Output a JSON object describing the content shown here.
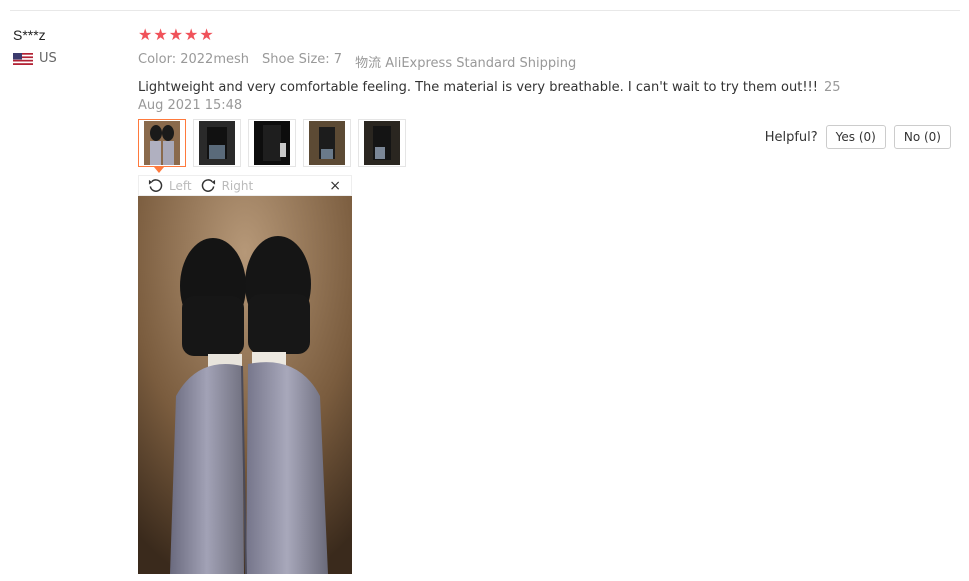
{
  "reviewer": {
    "name": "S***z",
    "country": "US"
  },
  "review": {
    "rating": 5,
    "attributes": [
      {
        "label": "Color:",
        "value": "2022mesh"
      },
      {
        "label": "Shoe Size:",
        "value": "7"
      },
      {
        "label": "物流",
        "value": "AliExpress Standard Shipping"
      }
    ],
    "text": "Lightweight and very comfortable feeling. The material is very breathable. I can't wait to try them out!!!",
    "date": "25 Aug 2021 15:48"
  },
  "thumbnails": [
    {
      "alt": "photo-1"
    },
    {
      "alt": "photo-2"
    },
    {
      "alt": "photo-3"
    },
    {
      "alt": "photo-4"
    },
    {
      "alt": "photo-5"
    }
  ],
  "helpful": {
    "label": "Helpful?",
    "yes": "Yes (0)",
    "no": "No (0)"
  },
  "viewer": {
    "left": "Left",
    "right": "Right",
    "close": "×"
  },
  "colors": {
    "star": "#f0525a",
    "active_border": "#ff7a3d"
  }
}
